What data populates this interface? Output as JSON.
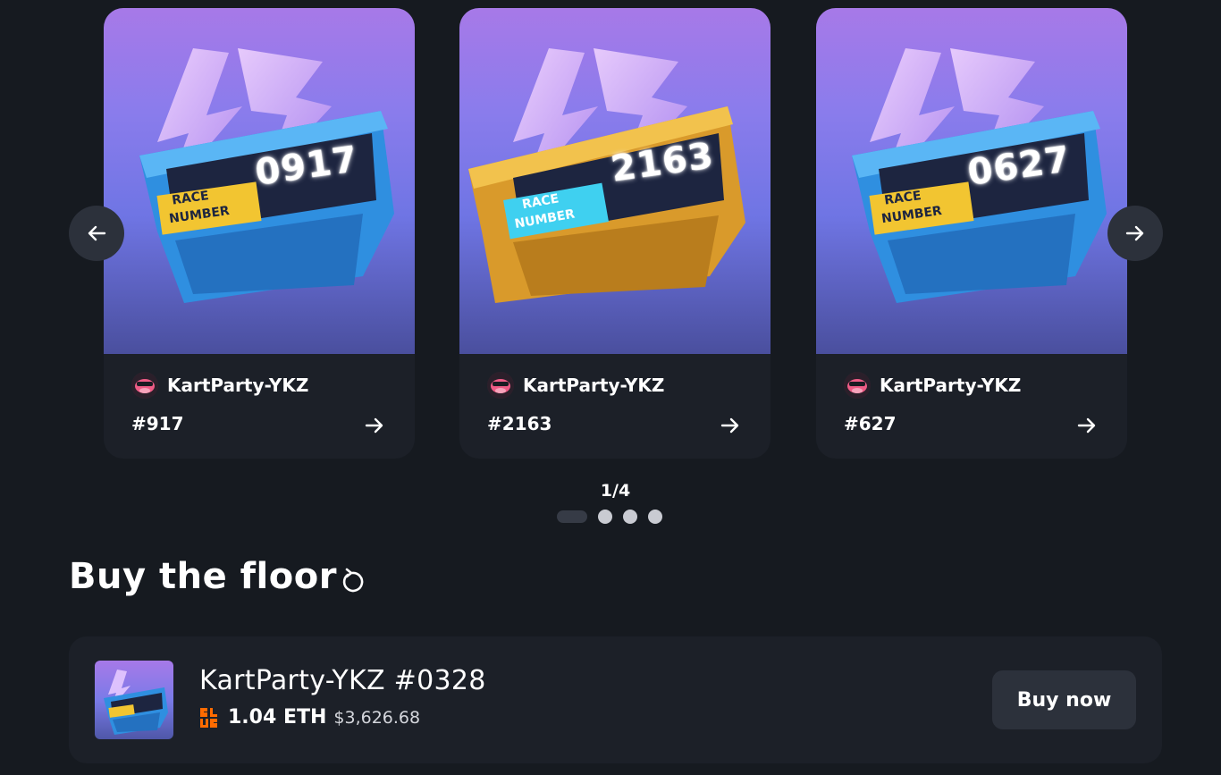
{
  "carousel": {
    "cards": [
      {
        "art_number": "0917",
        "badge_text_1": "RACE",
        "badge_text_2": "NUMBER",
        "collection": "KartParty-YKZ",
        "token": "#917",
        "scheme": "blue"
      },
      {
        "art_number": "2163",
        "badge_text_1": "RACE",
        "badge_text_2": "NUMBER",
        "collection": "KartParty-YKZ",
        "token": "#2163",
        "scheme": "gold"
      },
      {
        "art_number": "0627",
        "badge_text_1": "RACE",
        "badge_text_2": "NUMBER",
        "collection": "KartParty-YKZ",
        "token": "#627",
        "scheme": "blue"
      }
    ],
    "pager": "1/4",
    "page_count": 4,
    "active_page": 1,
    "prev_icon": "arrow-left-icon",
    "next_icon": "arrow-right-icon"
  },
  "buy_floor": {
    "title": "Buy the floor",
    "refresh_icon": "refresh-icon",
    "item": {
      "name": "KartParty-YKZ #0328",
      "marketplace_icon": "blur-logo-icon",
      "price_eth": "1.04 ETH",
      "price_usd": "$3,626.68",
      "buy_label": "Buy now"
    }
  },
  "colors": {
    "background": "#161a20",
    "card_background": "#1c2028",
    "button_background": "#2c313b",
    "blur_orange": "#ff6b00",
    "art_blue": "#2f8fe0",
    "art_gold": "#d99a2b"
  }
}
